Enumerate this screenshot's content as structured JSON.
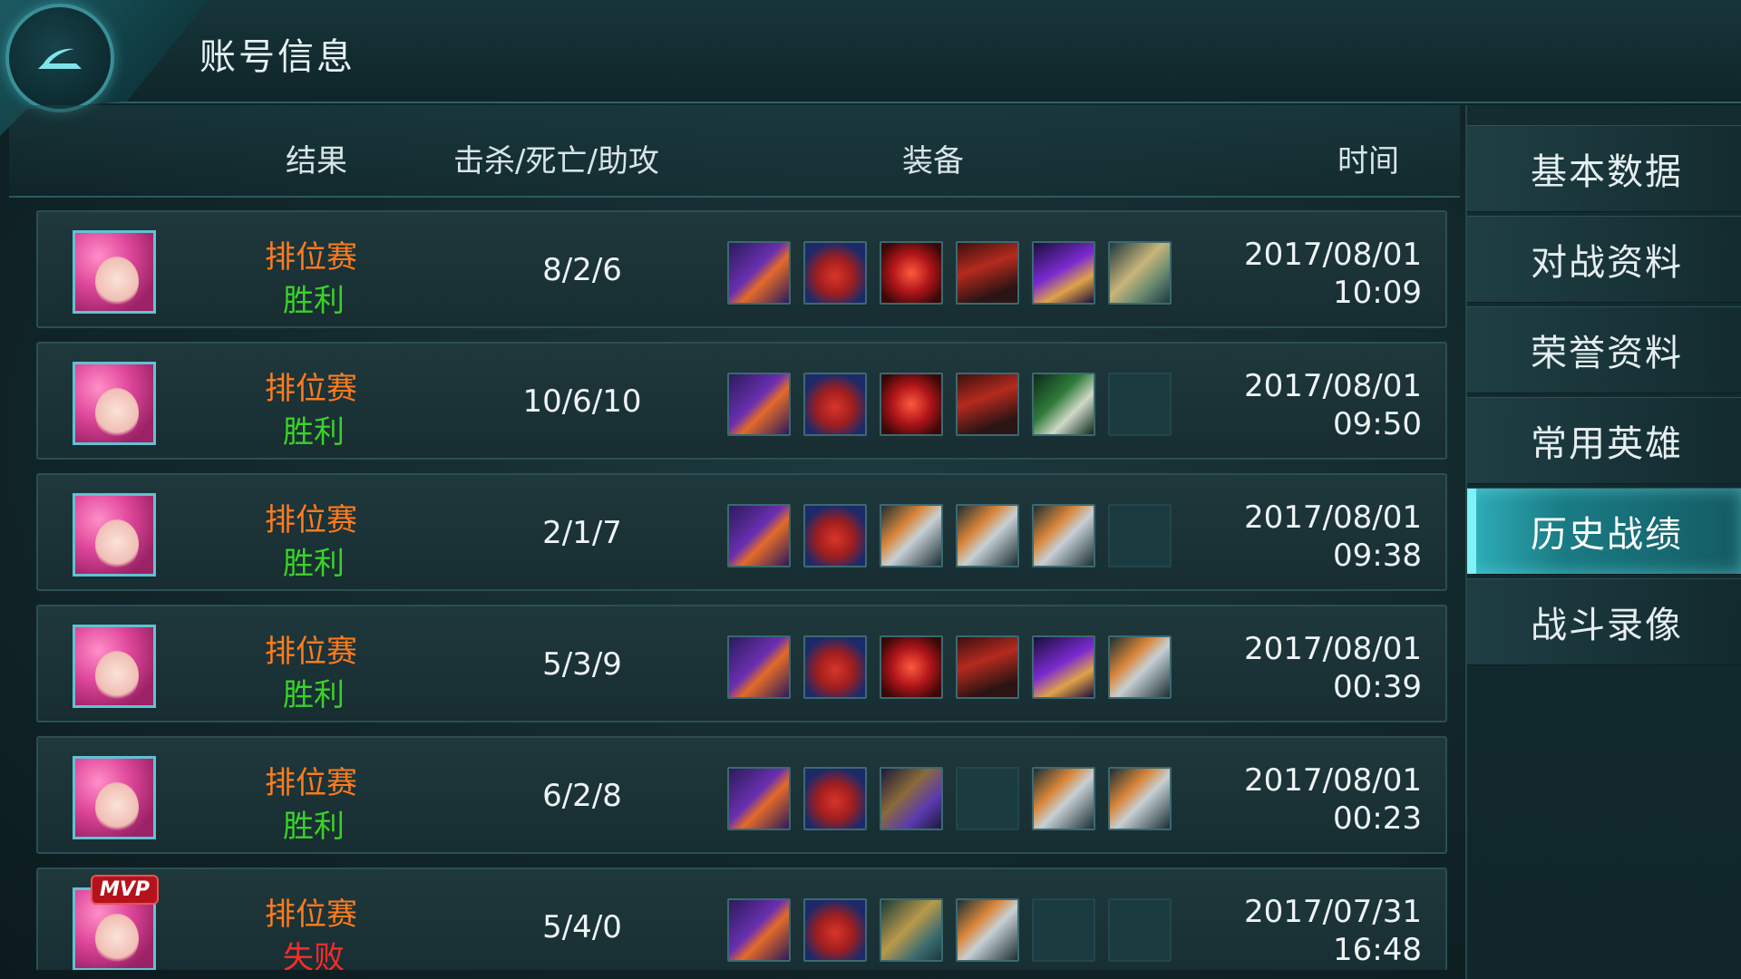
{
  "header": {
    "title": "账号信息"
  },
  "table": {
    "headers": {
      "result": "结果",
      "kda": "击杀/死亡/助攻",
      "equipment": "装备",
      "time": "时间"
    },
    "rows": [
      {
        "mode": "排位赛",
        "outcome": "胜利",
        "outcome_type": "win",
        "kda": "8/2/6",
        "date": "2017/08/01",
        "clock": "10:09",
        "mvp": false,
        "items": [
          "staff-icon",
          "boots-icon",
          "amulet-icon",
          "armor-icon",
          "wing-icon",
          "trident-icon"
        ]
      },
      {
        "mode": "排位赛",
        "outcome": "胜利",
        "outcome_type": "win",
        "kda": "10/6/10",
        "date": "2017/08/01",
        "clock": "09:50",
        "mvp": false,
        "items": [
          "staff-icon",
          "boots-icon",
          "amulet-icon",
          "armor-icon",
          "dagger-icon",
          "empty"
        ]
      },
      {
        "mode": "排位赛",
        "outcome": "胜利",
        "outcome_type": "win",
        "kda": "2/1/7",
        "date": "2017/08/01",
        "clock": "09:38",
        "mvp": false,
        "items": [
          "staff-icon",
          "boots-icon",
          "swords-icon",
          "swords-icon",
          "swords-icon",
          "empty"
        ]
      },
      {
        "mode": "排位赛",
        "outcome": "胜利",
        "outcome_type": "win",
        "kda": "5/3/9",
        "date": "2017/08/01",
        "clock": "00:39",
        "mvp": false,
        "items": [
          "staff-icon",
          "boots-icon",
          "amulet-icon",
          "armor-icon",
          "wing-icon",
          "swords-icon"
        ]
      },
      {
        "mode": "排位赛",
        "outcome": "胜利",
        "outcome_type": "win",
        "kda": "6/2/8",
        "date": "2017/08/01",
        "clock": "00:23",
        "mvp": false,
        "items": [
          "staff-icon",
          "boots-icon",
          "axe-icon",
          "empty",
          "swords-icon",
          "swords-icon"
        ]
      },
      {
        "mode": "排位赛",
        "outcome": "失败",
        "outcome_type": "lose",
        "kda": "5/4/0",
        "date": "2017/07/31",
        "clock": "16:48",
        "mvp": true,
        "mvp_label": "MVP",
        "items": [
          "staff-icon",
          "boots-icon",
          "fork-icon",
          "swords-icon",
          "empty",
          "empty"
        ]
      }
    ]
  },
  "sidebar": {
    "items": [
      {
        "label": "基本数据",
        "active": false
      },
      {
        "label": "对战资料",
        "active": false
      },
      {
        "label": "荣誉资料",
        "active": false
      },
      {
        "label": "常用英雄",
        "active": false
      },
      {
        "label": "历史战绩",
        "active": true
      },
      {
        "label": "战斗录像",
        "active": false
      }
    ]
  },
  "colors": {
    "accent": "#2fb0bb",
    "win": "#3bd12a",
    "lose": "#ff2a2a",
    "mode": "#ff7b1c"
  }
}
